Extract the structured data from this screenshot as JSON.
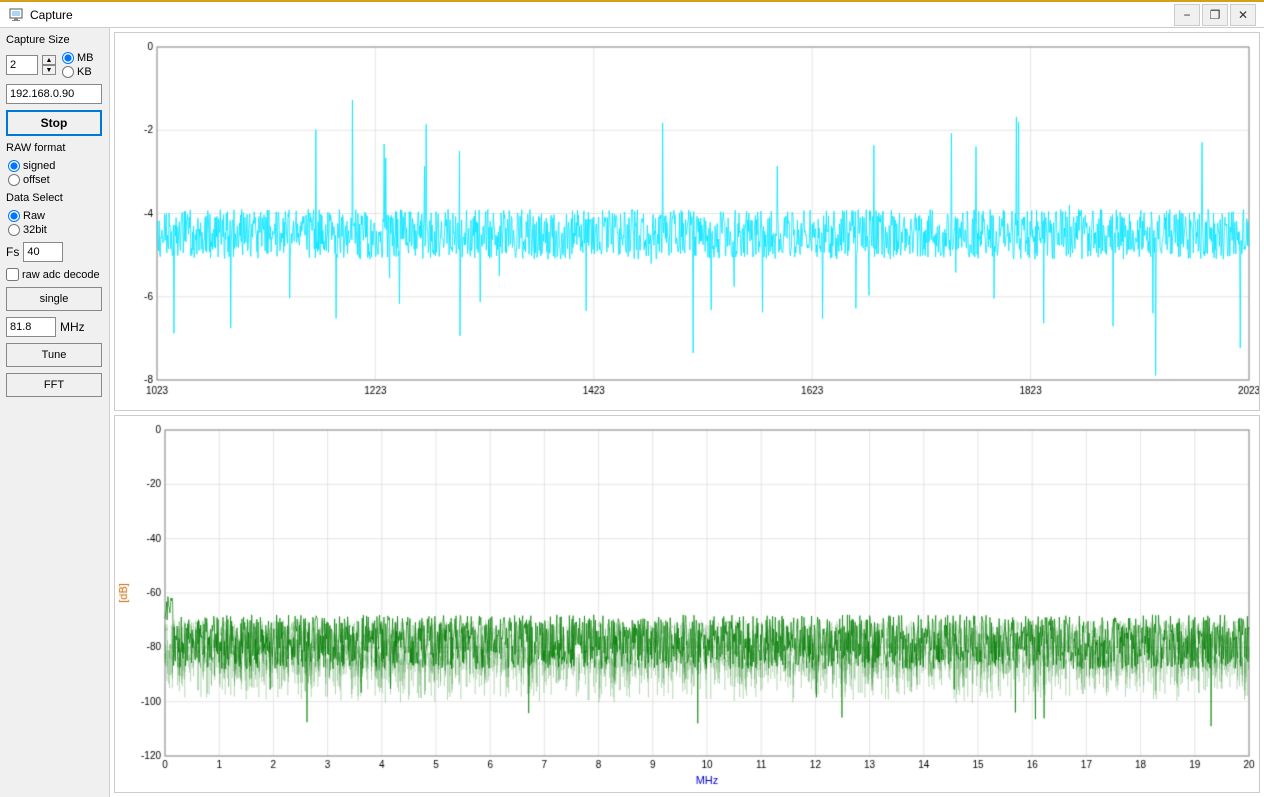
{
  "window": {
    "title": "Capture",
    "icon": "camera-icon"
  },
  "titlebar": {
    "minimize_label": "−",
    "restore_label": "❐",
    "close_label": "✕"
  },
  "sidebar": {
    "capture_size_label": "Capture Size",
    "capture_size_value": "2",
    "mb_label": "MB",
    "kb_label": "KB",
    "ip_value": "192.168.0.90",
    "stop_label": "Stop",
    "raw_format_label": "RAW format",
    "signed_label": "signed",
    "offset_label": "offset",
    "data_select_label": "Data Select",
    "raw_label": "Raw",
    "bit32_label": "32bit",
    "fs_label": "Fs",
    "fs_value": "40",
    "raw_adc_decode_label": "raw adc decode",
    "single_label": "single",
    "mhz_value": "81.8",
    "mhz_label": "MHz",
    "tune_label": "Tune",
    "fft_label": "FFT"
  },
  "chart_top": {
    "y_axis": [
      0,
      -2,
      -4,
      -6,
      -8
    ],
    "x_axis": [
      1023,
      1223,
      1423,
      1623,
      1823,
      2023
    ],
    "color": "#00ffff"
  },
  "chart_bottom": {
    "y_axis": [
      0,
      -20,
      -40,
      -60,
      -80,
      -100,
      -120
    ],
    "x_axis": [
      0,
      1,
      2,
      3,
      4,
      5,
      6,
      7,
      8,
      9,
      10,
      11,
      12,
      13,
      14,
      15,
      16,
      17,
      18,
      19,
      20
    ],
    "x_label": "MHz",
    "y_label": "[dB]",
    "color": "#008000"
  }
}
